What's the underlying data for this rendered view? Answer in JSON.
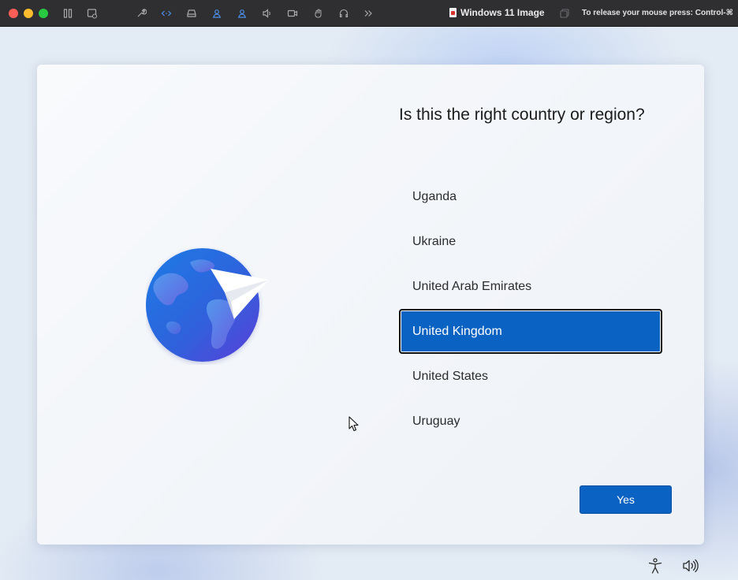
{
  "toolbar": {
    "vm_title": "Windows 11 Image",
    "release_hint": "To release your mouse press: Control-⌘",
    "icons": [
      "pause-icon",
      "snapshot-icon",
      "settings-wrench-icon",
      "code-icon",
      "drive-icon",
      "user-share-icon",
      "user-share-alt-icon",
      "speaker-icon",
      "camera-icon",
      "mouse-icon",
      "headphones-icon",
      "more-chevron-icon",
      "copy-icon"
    ]
  },
  "oobe": {
    "heading": "Is this the right country or region?",
    "countries": [
      {
        "label": "Uganda",
        "selected": false
      },
      {
        "label": "Ukraine",
        "selected": false
      },
      {
        "label": "United Arab Emirates",
        "selected": false
      },
      {
        "label": "United Kingdom",
        "selected": true
      },
      {
        "label": "United States",
        "selected": false
      },
      {
        "label": "Uruguay",
        "selected": false
      }
    ],
    "yes_label": "Yes",
    "accent": "#0a62c2"
  },
  "taskbar": {
    "icons": [
      "accessibility-icon",
      "volume-icon"
    ]
  }
}
